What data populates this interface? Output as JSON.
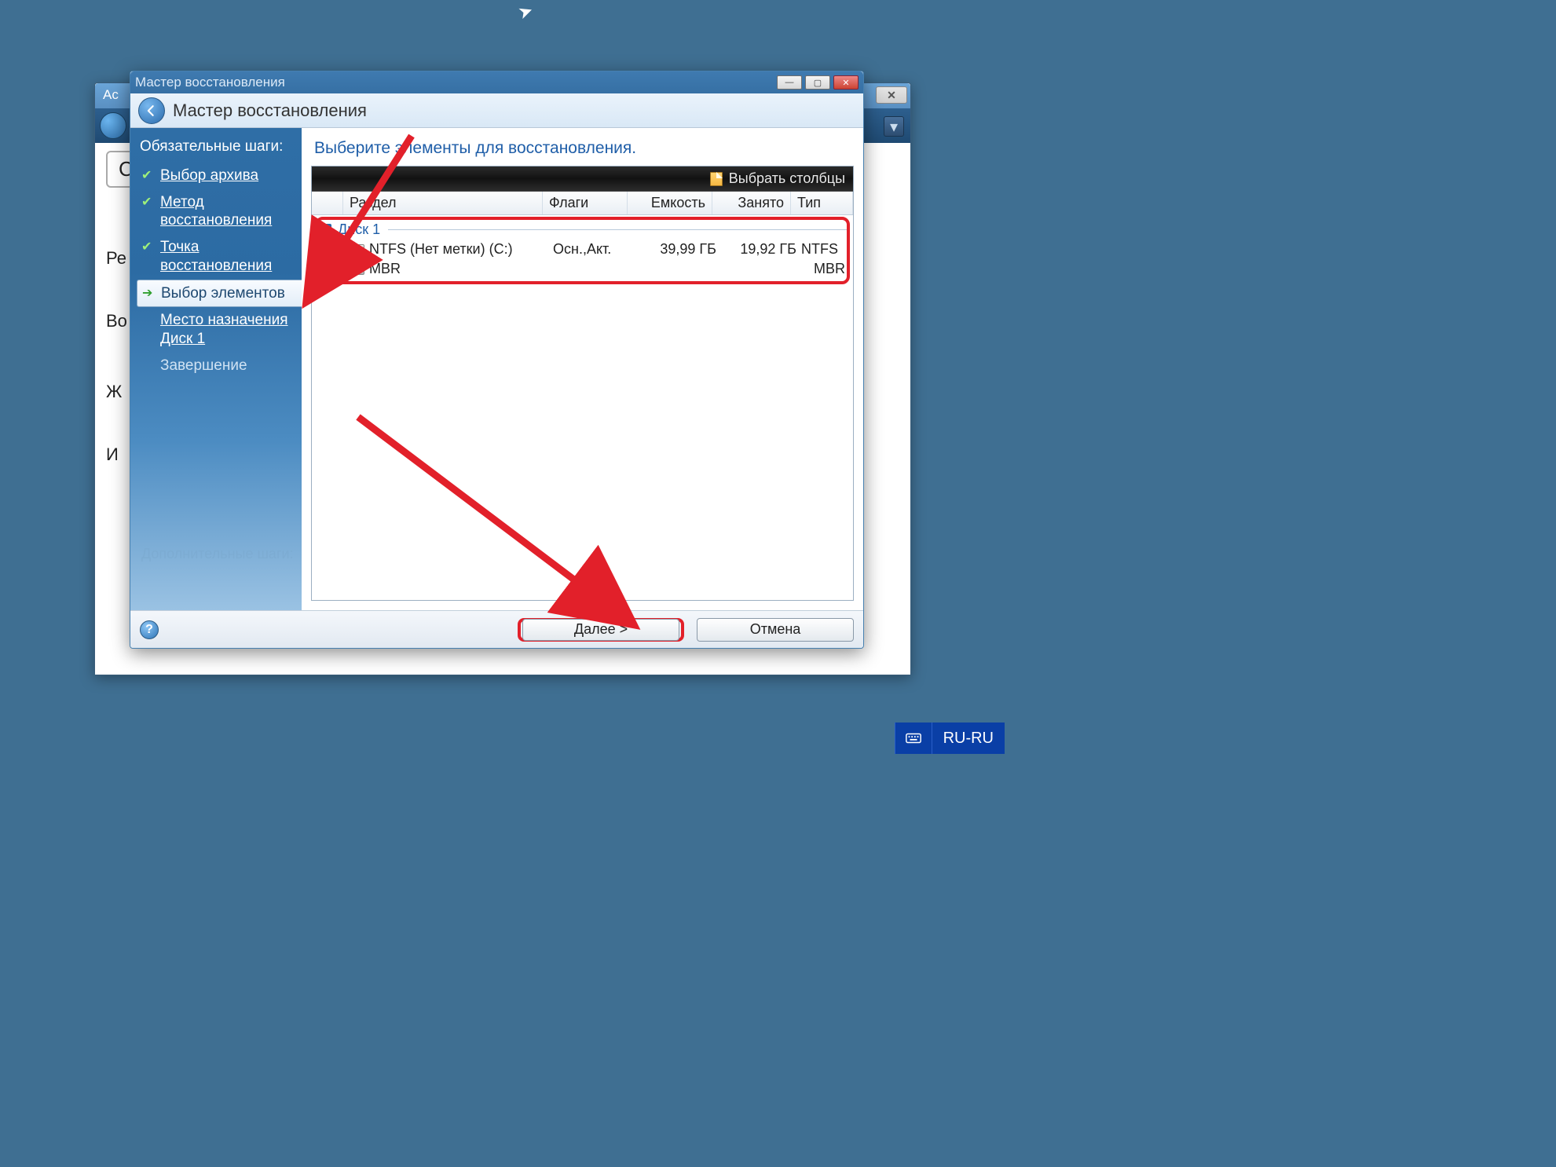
{
  "bg_window": {
    "title_prefix": "Ac",
    "search_stub": "C",
    "left_stubs": [
      "Ре",
      "Во",
      "Ж",
      "И"
    ]
  },
  "wizard": {
    "titlebar": "Мастер восстановления",
    "header_title": "Мастер восстановления",
    "sidebar": {
      "section": "Обязательные шаги:",
      "steps": [
        {
          "label": "Выбор архива",
          "state": "done"
        },
        {
          "label": "Метод восстановления",
          "state": "done"
        },
        {
          "label": "Точка восстановления",
          "state": "done"
        },
        {
          "label": "Выбор элементов",
          "state": "current"
        },
        {
          "label": "Место назначения Диск 1",
          "state": "link"
        },
        {
          "label": "Завершение",
          "state": "pending"
        }
      ],
      "optional_label": "Дополнительные шаги:"
    },
    "main": {
      "title": "Выберите элементы для восстановления.",
      "select_columns": "Выбрать столбцы",
      "columns": [
        "",
        "Раздел",
        "Флаги",
        "Емкость",
        "Занято",
        "Тип"
      ],
      "group": "Диск 1",
      "rows": [
        {
          "name": "NTFS (Нет метки) (C:)",
          "flags": "Осн.,Акт.",
          "capacity": "39,99 ГБ",
          "used": "19,92 ГБ",
          "type": "NTFS",
          "checked": true
        },
        {
          "name": "MBR",
          "flags": "",
          "capacity": "",
          "used": "",
          "type": "MBR",
          "checked": true
        }
      ]
    },
    "footer": {
      "next": "Далее >",
      "cancel": "Отмена"
    }
  },
  "taskbar": {
    "lang": "RU-RU"
  }
}
